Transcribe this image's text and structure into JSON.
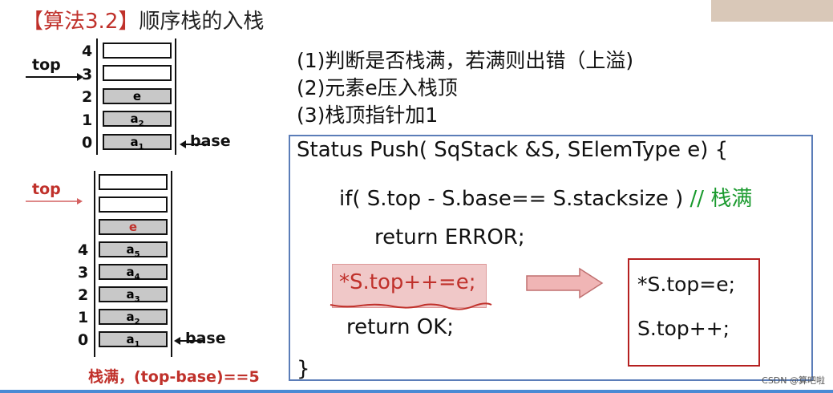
{
  "title": {
    "bracket_open": "【",
    "tag": "算法3.2",
    "bracket_close": "】",
    "text": "顺序栈的入栈"
  },
  "stack_top": {
    "indices": [
      "4",
      "3",
      "2",
      "1",
      "0"
    ],
    "cells": [
      "",
      "",
      "e",
      "a",
      "a"
    ],
    "subs": [
      "",
      "",
      "",
      "2",
      "1"
    ],
    "top_label": "top",
    "base_label": "base"
  },
  "stack_bottom": {
    "indices": [
      "4",
      "3",
      "2",
      "1",
      "0"
    ],
    "cells": [
      "",
      "",
      "e",
      "a",
      "a",
      "a",
      "a",
      "a"
    ],
    "subs": [
      "",
      "",
      "",
      "5",
      "4",
      "3",
      "2",
      "1"
    ],
    "top_label": "top",
    "base_label": "base",
    "full_note": "栈满，(top-base)==5"
  },
  "steps": [
    "(1)判断是否栈满，若满则出错（上溢)",
    "(2)元素e压入栈顶",
    "(3)栈顶指针加1"
  ],
  "code": {
    "line1": "Status Push( SqStack &S, SElemType e) {",
    "line2": "if( S.top - S.base== S.stacksize )",
    "line2_comment": "// 栈满",
    "line3": "return ERROR;",
    "line4": "*S.top++=e;",
    "line5": "return OK;",
    "line6": "}"
  },
  "expansion": {
    "line1": "*S.top=e;",
    "line2": "S.top++;"
  },
  "watermark": "CSDN @算吧啦",
  "colors": {
    "accent_red": "#c0312b",
    "comment_green": "#1a9a2e",
    "box_blue": "#5b7db8"
  }
}
